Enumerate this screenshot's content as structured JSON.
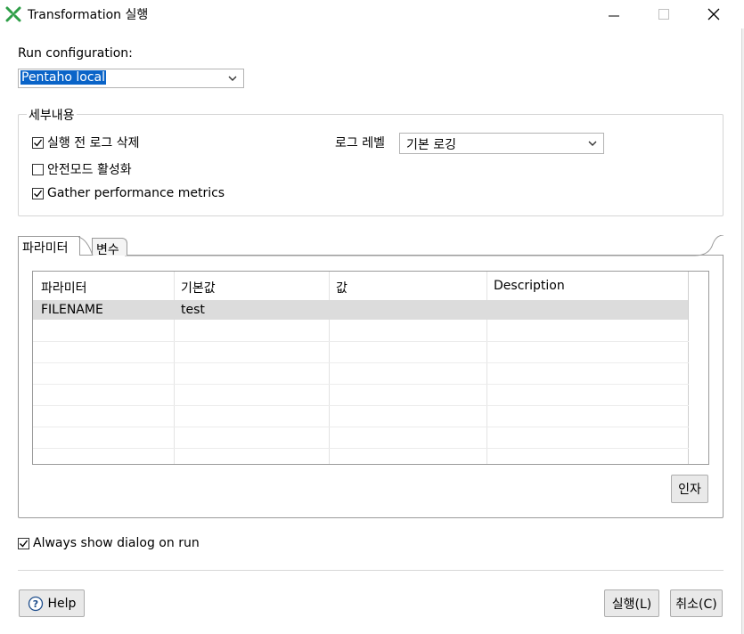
{
  "window": {
    "title": "Transformation 실행"
  },
  "run_configuration": {
    "label": "Run configuration:",
    "value": "Pentaho local"
  },
  "details": {
    "legend": "세부내용",
    "checkboxes": [
      {
        "label": "실행 전 로그 삭제",
        "checked": true
      },
      {
        "label": "안전모드 활성화",
        "checked": false
      },
      {
        "label": "Gather performance metrics",
        "checked": true
      }
    ],
    "log_level_label": "로그 레벨",
    "log_level_value": "기본 로깅"
  },
  "tabs": {
    "items": [
      {
        "label": "파라미터",
        "active": true
      },
      {
        "label": "변수",
        "active": false
      }
    ]
  },
  "table": {
    "headers": [
      "파라미터",
      "기본값",
      "값",
      "Description"
    ],
    "rows": [
      [
        "FILENAME",
        "test",
        "",
        ""
      ]
    ]
  },
  "buttons": {
    "arguments": "인자",
    "help": "Help",
    "run": "실행(L)",
    "cancel": "취소(C)"
  },
  "always_show": {
    "label": "Always show dialog on run",
    "checked": true
  },
  "colors": {
    "selection": "#0a64c8",
    "selected_row": "#dcdcdc",
    "icon_green": "#2e9e47"
  }
}
